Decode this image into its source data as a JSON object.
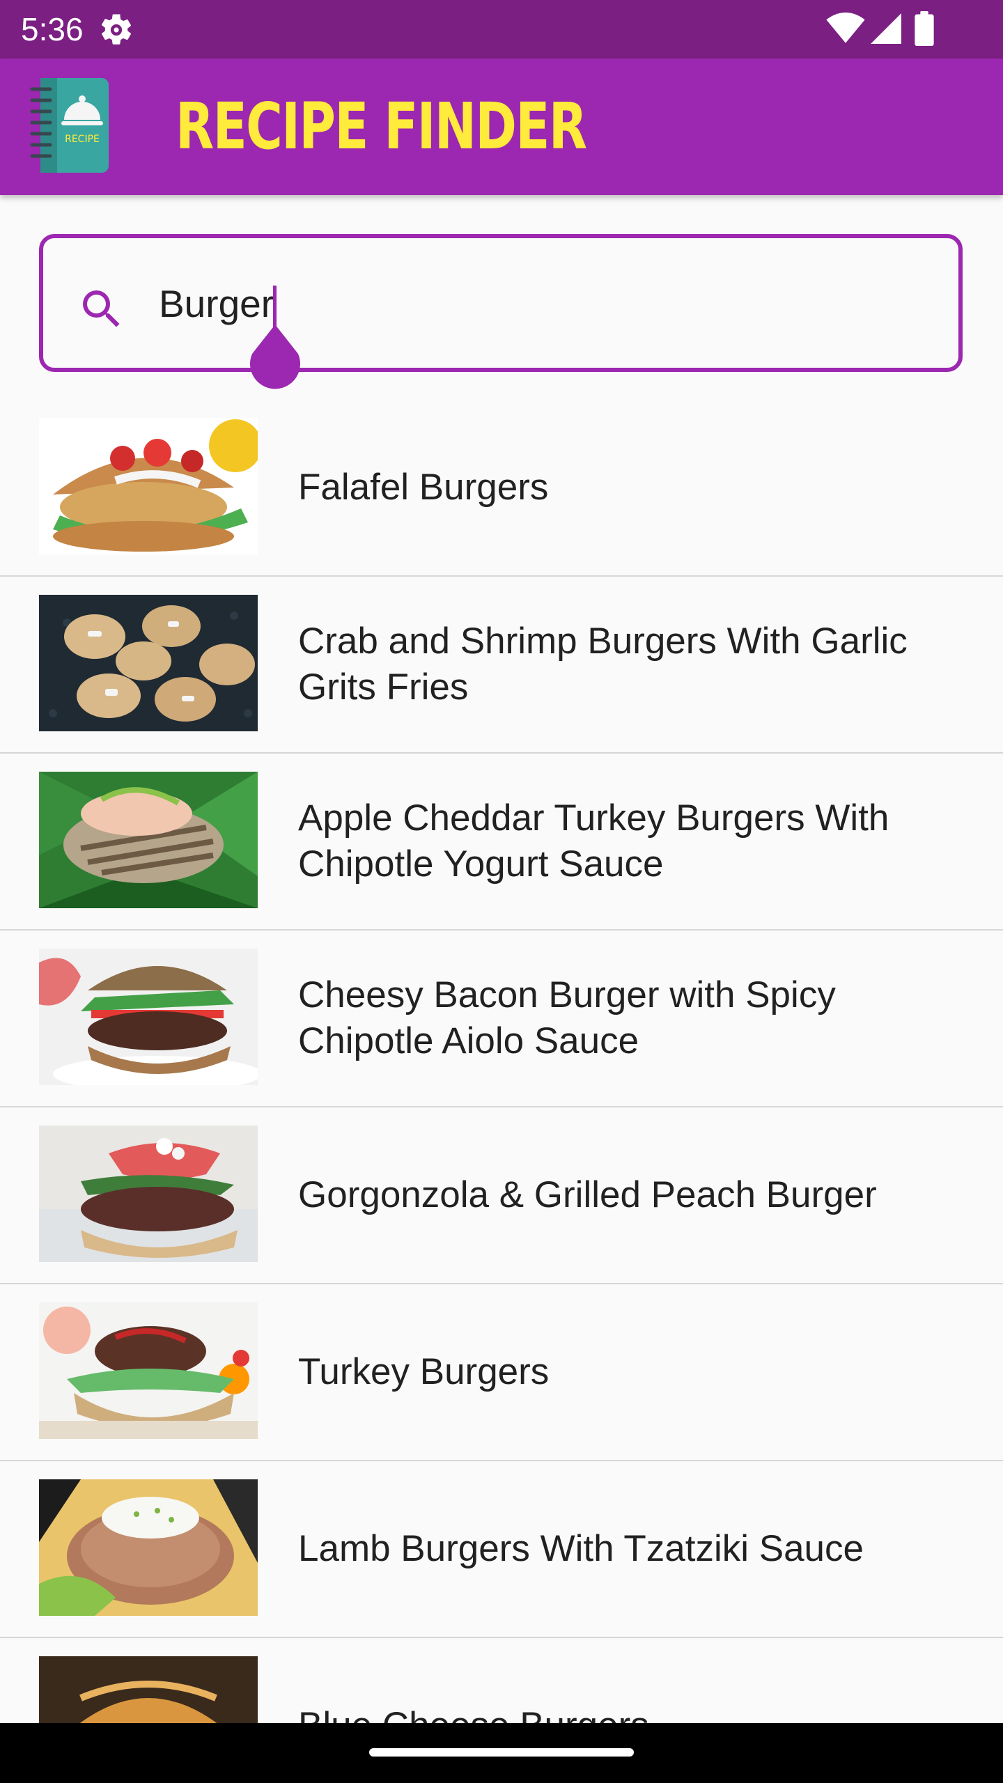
{
  "status_bar": {
    "time": "5:36",
    "icons": [
      "settings-gear-icon",
      "wifi-icon",
      "signal-icon",
      "battery-icon"
    ]
  },
  "app_bar": {
    "title": "RECIPE FINDER",
    "logo_label": "RECIPE",
    "colors": {
      "background": "#9c27b0",
      "title": "#ffeb3b",
      "status_bar": "#7b1f82"
    }
  },
  "search": {
    "value": "Burger",
    "icon": "search-icon"
  },
  "recipes": [
    {
      "title": "Falafel Burgers"
    },
    {
      "title": "Crab and Shrimp Burgers With Garlic Grits Fries"
    },
    {
      "title": "Apple Cheddar Turkey Burgers With Chipotle Yogurt Sauce"
    },
    {
      "title": "Cheesy Bacon Burger with Spicy Chipotle Aiolo Sauce"
    },
    {
      "title": "Gorgonzola & Grilled Peach Burger"
    },
    {
      "title": "Turkey Burgers"
    },
    {
      "title": "Lamb Burgers With Tzatziki Sauce"
    },
    {
      "title": "Blue Cheese Burgers"
    }
  ]
}
